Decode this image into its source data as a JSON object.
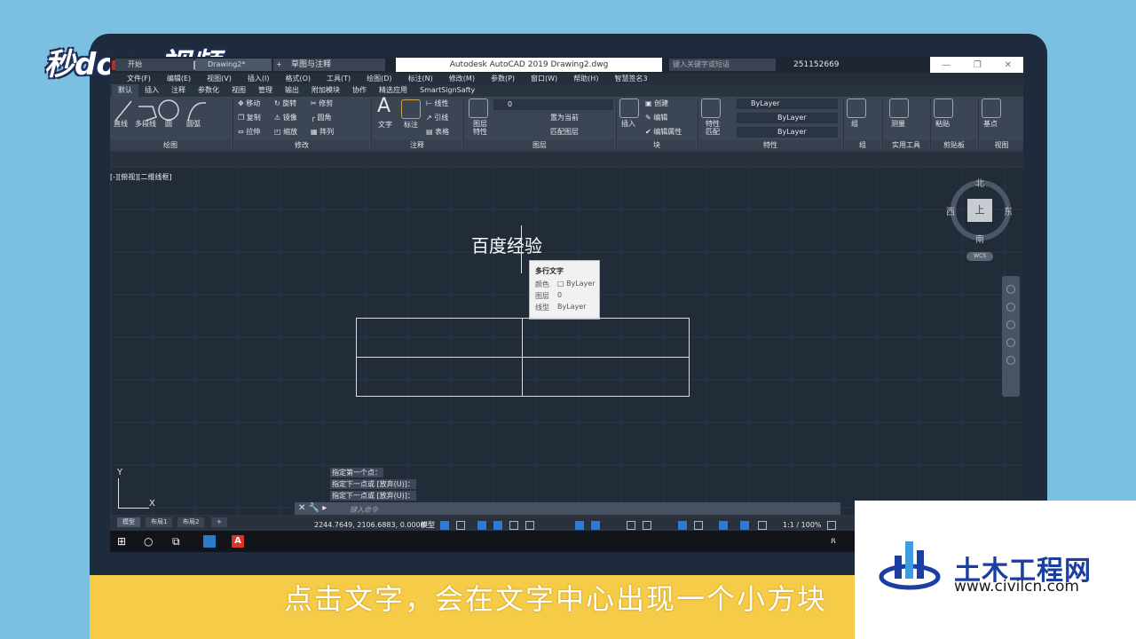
{
  "brand_logo": "秒dong视频",
  "caption": "点击文字，会在文字中心出现一个小方块",
  "watermark": {
    "title": "土木工程网",
    "url": "www.civilcn.com"
  },
  "window": {
    "title": "Autodesk AutoCAD 2019    Drawing2.dwg",
    "workspace": "草图与注释",
    "search_placeholder": "键入关键字或短语",
    "user": "251152669"
  },
  "menubar": [
    "文件(F)",
    "编辑(E)",
    "视图(V)",
    "插入(I)",
    "格式(O)",
    "工具(T)",
    "绘图(D)",
    "标注(N)",
    "修改(M)",
    "参数(P)",
    "窗口(W)",
    "帮助(H)",
    "智慧签名3"
  ],
  "ribbon_tabs": [
    "默认",
    "插入",
    "注释",
    "参数化",
    "视图",
    "管理",
    "输出",
    "附加模块",
    "协作",
    "精选应用",
    "SmartSignSafty"
  ],
  "ribbon": {
    "draw": {
      "title": "绘图",
      "line": "直线",
      "polyline": "多段线",
      "circle": "圆",
      "arc": "圆弧"
    },
    "modify": {
      "title": "修改",
      "move": "移动",
      "rotate": "旋转",
      "trim": "修剪",
      "copy": "复制",
      "mirror": "镜像",
      "fillet": "圆角",
      "stretch": "拉伸",
      "scale": "缩放",
      "array": "阵列"
    },
    "annotation": {
      "title": "注释",
      "text": "文字",
      "dimension": "标注",
      "linear": "线性",
      "leader": "引线",
      "table": "表格"
    },
    "layers": {
      "title": "图层",
      "props": "图层\n特性",
      "current_layer": "0",
      "set_current": "置为当前",
      "match_layer": "匹配图层"
    },
    "block": {
      "title": "块",
      "insert": "插入",
      "create": "创建",
      "edit": "编辑",
      "edit_attr": "编辑属性"
    },
    "properties": {
      "title": "特性",
      "match": "特性\n匹配",
      "color": "ByLayer",
      "lineweight": "ByLayer",
      "linetype": "ByLayer"
    },
    "groups": {
      "title": "组",
      "group": "组"
    },
    "utilities": {
      "title": "实用工具",
      "measure": "测量"
    },
    "clipboard": {
      "title": "剪贴板",
      "paste": "粘贴"
    },
    "view": {
      "title": "视图",
      "base": "基点"
    }
  },
  "doc_tabs": [
    "开始",
    "Drawing2*"
  ],
  "viewport_label": "[-][俯视][二维线框]",
  "drawing_text": "百度经验",
  "tooltip": {
    "title": "多行文字",
    "rows": [
      {
        "label": "颜色",
        "value": "□ ByLayer"
      },
      {
        "label": "图层",
        "value": "0"
      },
      {
        "label": "线型",
        "value": "ByLayer"
      }
    ]
  },
  "viewcube": {
    "top": "上",
    "north": "北",
    "south": "南",
    "east": "东",
    "west": "西",
    "wcs": "WCS"
  },
  "ucs": {
    "x": "X",
    "y": "Y"
  },
  "command_history": [
    "指定第一个点：",
    "指定下一点或 [放弃(U)]：",
    "指定下一点或 [放弃(U)]："
  ],
  "command_placeholder": "键入命令",
  "layout_tabs": [
    "模型",
    "布局1",
    "布局2"
  ],
  "status": {
    "coords": "2244.7649, 2106.6883, 0.0000",
    "mode": "模型",
    "scale": "1:1 / 100%"
  }
}
